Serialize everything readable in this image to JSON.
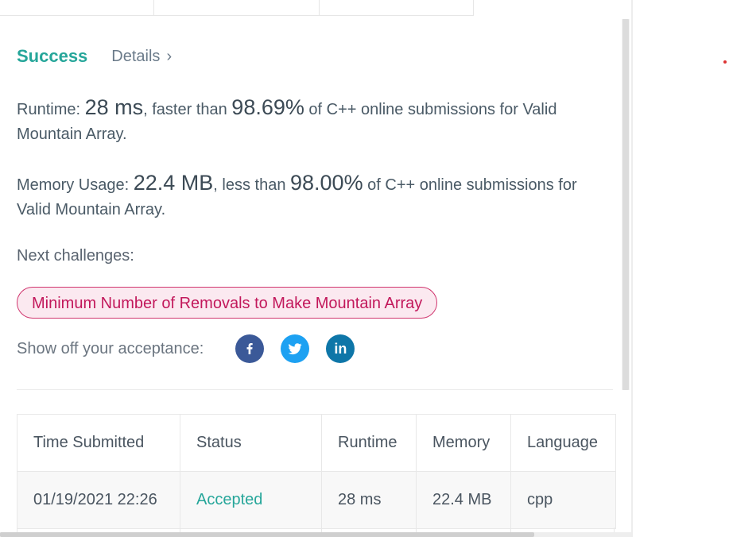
{
  "result": {
    "status": "Success",
    "details_label": "Details",
    "details_chevron": "›"
  },
  "runtime": {
    "prefix": "Runtime: ",
    "value": "28 ms",
    "middle": ", faster than ",
    "percent": "98.69%",
    "suffix": " of C++ online submissions for Valid Mountain Array."
  },
  "memory": {
    "prefix": "Memory Usage: ",
    "value": "22.4 MB",
    "middle": ", less than ",
    "percent": "98.00%",
    "suffix": " of C++ online submissions for Valid Mountain Array."
  },
  "next_challenges": {
    "label": "Next challenges:",
    "items": [
      "Minimum Number of Removals to Make Mountain Array"
    ]
  },
  "share": {
    "label": "Show off your acceptance:",
    "icons": [
      "facebook-icon",
      "twitter-icon",
      "linkedin-icon"
    ],
    "linkedin_text": "in"
  },
  "submissions": {
    "headers": [
      "Time Submitted",
      "Status",
      "Runtime",
      "Memory",
      "Language"
    ],
    "rows": [
      {
        "time": "01/19/2021 22:26",
        "status": "Accepted",
        "runtime": "28 ms",
        "memory": "22.4 MB",
        "language": "cpp"
      }
    ]
  },
  "colors": {
    "success": "#26a69a",
    "challenge_text": "#c2185b",
    "challenge_bg": "#fbe9f0",
    "facebook": "#3b5998",
    "twitter": "#1da1f2",
    "linkedin": "#0e76a8"
  }
}
